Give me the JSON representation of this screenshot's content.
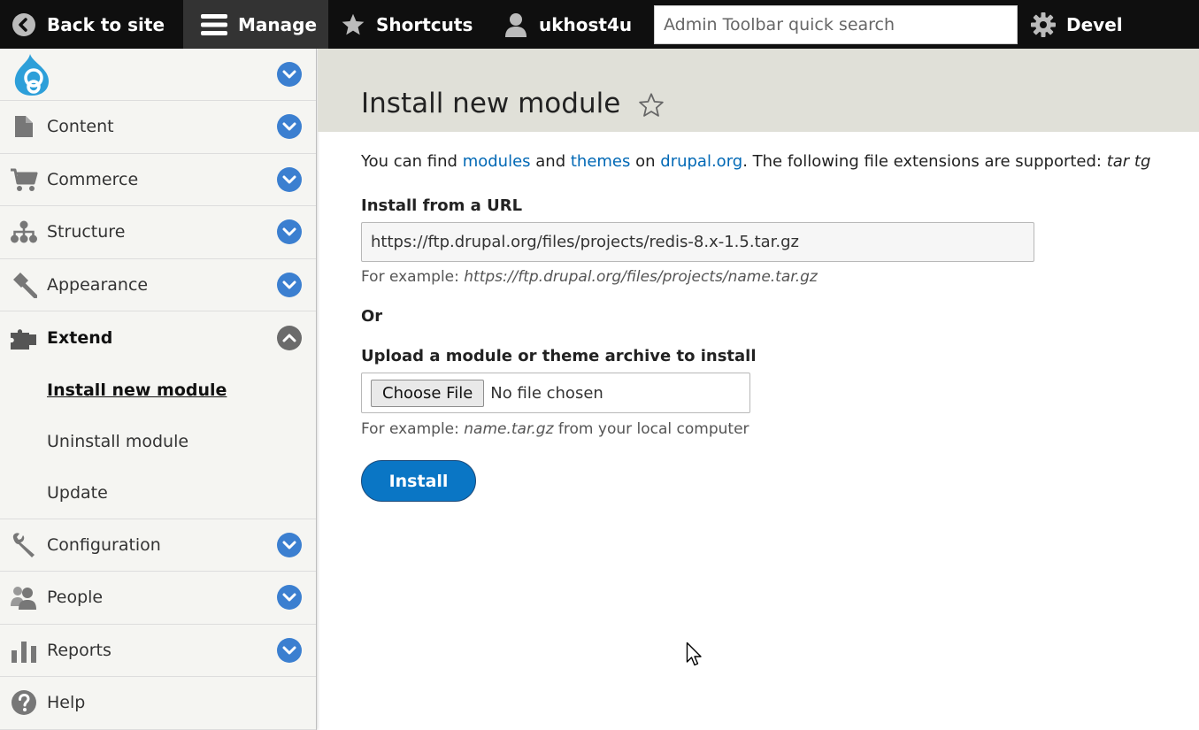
{
  "toolbar": {
    "back_label": "Back to site",
    "manage_label": "Manage",
    "shortcuts_label": "Shortcuts",
    "user_label": "ukhost4u",
    "search_placeholder": "Admin Toolbar quick search",
    "devel_label": "Devel"
  },
  "sidebar": {
    "items": [
      {
        "label": "Content",
        "icon": "file-icon"
      },
      {
        "label": "Commerce",
        "icon": "cart-icon"
      },
      {
        "label": "Structure",
        "icon": "hierarchy-icon"
      },
      {
        "label": "Appearance",
        "icon": "brush-icon"
      },
      {
        "label": "Extend",
        "icon": "puzzle-icon",
        "expanded": true
      },
      {
        "label": "Configuration",
        "icon": "wrench-icon"
      },
      {
        "label": "People",
        "icon": "people-icon"
      },
      {
        "label": "Reports",
        "icon": "bar-chart-icon"
      },
      {
        "label": "Help",
        "icon": "help-icon"
      }
    ],
    "extend_children": [
      {
        "label": "Install new module",
        "current": true
      },
      {
        "label": "Uninstall module"
      },
      {
        "label": "Update"
      }
    ]
  },
  "page": {
    "title": "Install new module",
    "intro": {
      "part1": "You can find ",
      "link_modules": "modules",
      "part2": " and ",
      "link_themes": "themes",
      "part3": " on ",
      "link_drupal": "drupal.org",
      "part4": ". The following file extensions are supported: ",
      "extensions": "tar tg"
    },
    "url_label": "Install from a URL",
    "url_value": "https://ftp.drupal.org/files/projects/redis-8.x-1.5.tar.gz",
    "url_example_prefix": "For example: ",
    "url_example": "https://ftp.drupal.org/files/projects/name.tar.gz",
    "or_label": "Or",
    "upload_label": "Upload a module or theme archive to install",
    "choose_file_label": "Choose File",
    "no_file_label": "No file chosen",
    "file_example_prefix": "For example: ",
    "file_example": "name.tar.gz",
    "file_example_suffix": " from your local computer",
    "install_label": "Install"
  },
  "colors": {
    "toolbar_bg": "#0f0f0f",
    "manage_bg": "#333333",
    "link": "#0068b5",
    "install_button": "#0a76c5",
    "chevron": "#3b7fd0",
    "header_bg": "#e0e0d8"
  }
}
